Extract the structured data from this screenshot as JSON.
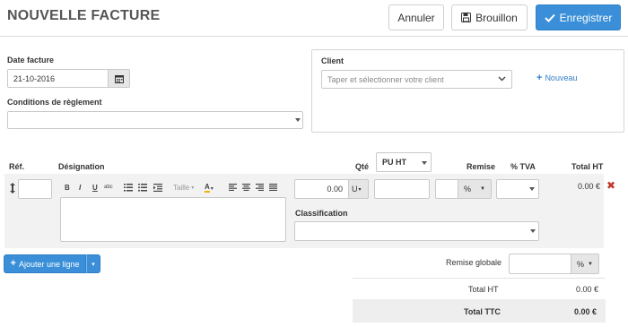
{
  "header": {
    "title": "NOUVELLE FACTURE",
    "cancel_label": "Annuler",
    "draft_label": "Brouillon",
    "save_label": "Enregistrer"
  },
  "invoice": {
    "date_label": "Date facture",
    "date_value": "21-10-2016",
    "payment_terms_label": "Conditions de règlement",
    "payment_terms_value": ""
  },
  "client": {
    "label": "Client",
    "placeholder": "Taper et sélectionner votre client",
    "new_label": "Nouveau"
  },
  "table": {
    "headers": {
      "ref": "Réf.",
      "designation": "Désignation",
      "qty": "Qté",
      "price_type": "PU HT",
      "discount": "Remise",
      "vat": "% TVA",
      "total": "Total HT"
    },
    "line": {
      "ref": "",
      "qty": "0.00",
      "unit": "U",
      "unit_price": "",
      "discount_value": "",
      "discount_type": "%",
      "vat": "",
      "total": "0.00 €",
      "classification_label": "Classification",
      "classification_value": ""
    },
    "editor_toolbar": [
      "B",
      "I",
      "U",
      "abc",
      "Taille",
      "A"
    ]
  },
  "add_line_label": "Ajouter une ligne",
  "summary": {
    "global_discount_label": "Remise globale",
    "global_discount_value": "",
    "global_discount_type": "%",
    "total_ht_label": "Total HT",
    "total_ht_value": "0.00 €",
    "total_ttc_label": "Total TTC",
    "total_ttc_value": "0.00 €"
  },
  "colors": {
    "primary": "#3a8fd8",
    "remove": "#c0392b",
    "link": "#2f7fc6"
  }
}
